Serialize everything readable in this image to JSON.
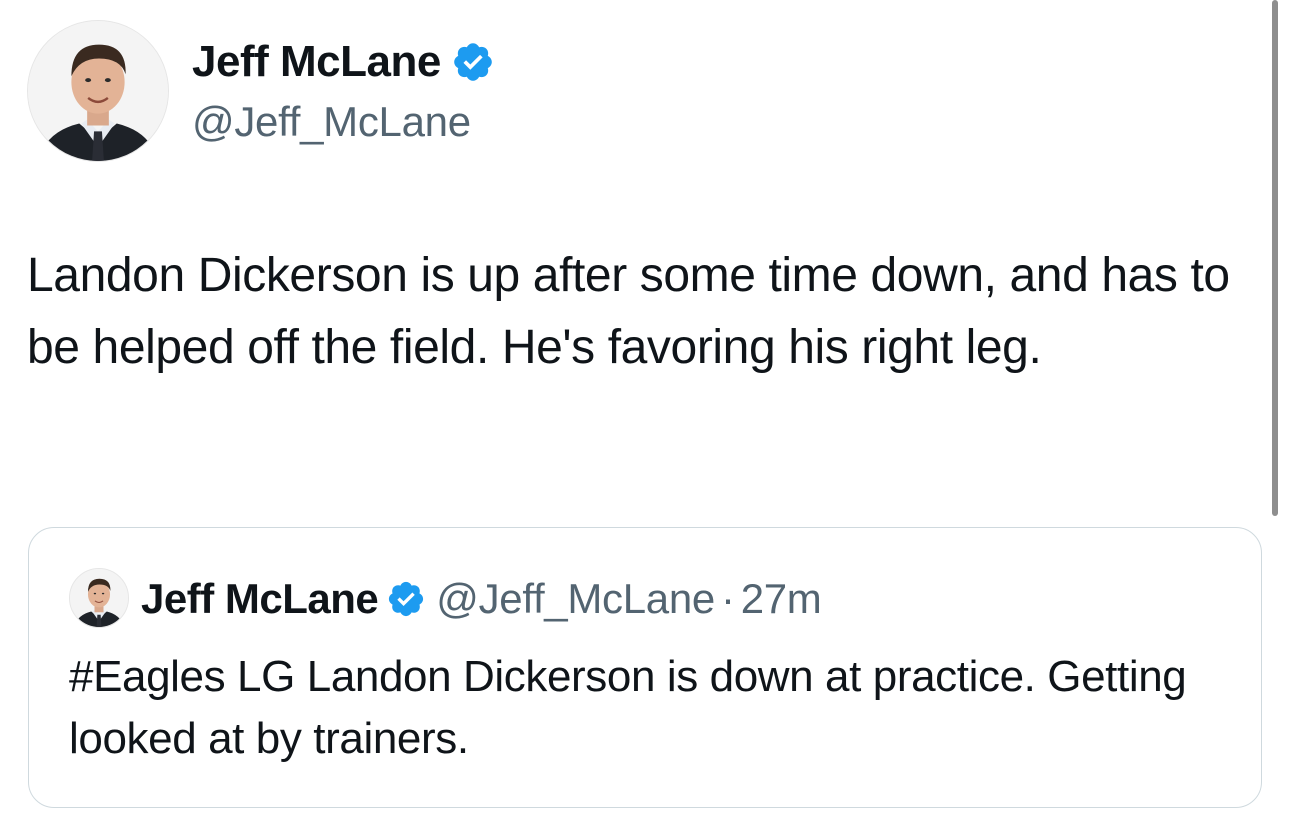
{
  "tweet": {
    "author": {
      "name": "Jeff McLane",
      "handle": "@Jeff_McLane",
      "avatar_icon": "profile-photo",
      "verified_icon": "verified-badge-icon",
      "verified_color": "#1d9bf0"
    },
    "text": "Landon Dickerson is up after some time down, and has to be helped off the field. He's favoring his right leg."
  },
  "quoted_tweet": {
    "author": {
      "name": "Jeff McLane",
      "handle": "@Jeff_McLane",
      "verified_icon": "verified-badge-icon"
    },
    "separator": "·",
    "time": "27m",
    "text": "#Eagles LG Landon Dickerson is down at practice. Getting looked at by trainers."
  },
  "colors": {
    "text_primary": "#0f1419",
    "text_secondary": "#536471",
    "border": "#cfd9de",
    "verified_blue": "#1d9bf0"
  }
}
